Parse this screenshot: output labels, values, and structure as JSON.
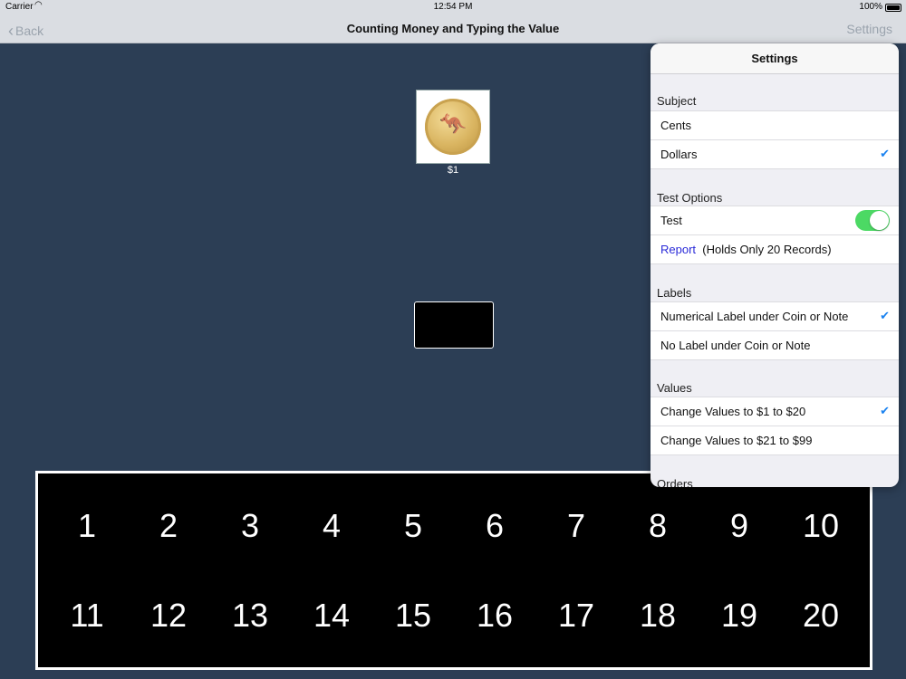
{
  "status": {
    "carrier": "Carrier",
    "time": "12:54 PM",
    "battery": "100%"
  },
  "nav": {
    "back": "Back",
    "title": "Counting Money and Typing the Value",
    "settings": "Settings"
  },
  "coin": {
    "label": "$1",
    "icon": "kangaroo-coin-icon"
  },
  "keypad": {
    "keys": [
      "1",
      "2",
      "3",
      "4",
      "5",
      "6",
      "7",
      "8",
      "9",
      "10",
      "11",
      "12",
      "13",
      "14",
      "15",
      "16",
      "17",
      "18",
      "19",
      "20"
    ]
  },
  "settings": {
    "title": "Settings",
    "subject": {
      "title": "Subject",
      "items": [
        "Cents",
        "Dollars"
      ],
      "selected": "Dollars"
    },
    "test_options": {
      "title": "Test Options",
      "test": "Test",
      "test_on": true,
      "report": "Report",
      "report_note": "(Holds Only 20 Records)"
    },
    "labels": {
      "title": "Labels",
      "items": [
        "Numerical Label under Coin or Note",
        "No Label under Coin or Note"
      ],
      "selected": "Numerical Label under Coin or Note"
    },
    "values": {
      "title": "Values",
      "items": [
        "Change Values to $1 to $20",
        "Change Values to $21 to $99"
      ],
      "selected": "Change Values to $1 to $20"
    },
    "orders": {
      "title": "Orders"
    }
  },
  "colors": {
    "background": "#2c3e55",
    "toggle_on": "#4cd964",
    "check": "#1a82f0"
  }
}
